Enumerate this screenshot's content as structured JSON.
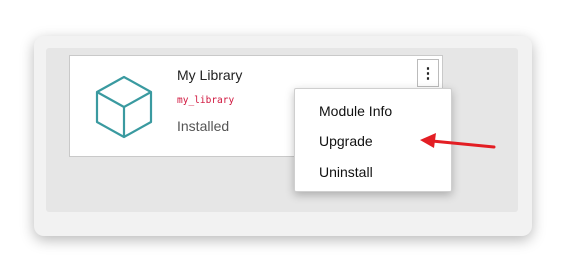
{
  "module": {
    "title": "My Library",
    "machine_name": "my_library",
    "status": "Installed",
    "icon": "cube-icon"
  },
  "actions_button": {
    "glyph": "⋮",
    "icon": "kebab-menu-icon"
  },
  "menu": {
    "items": [
      {
        "label": "Module Info"
      },
      {
        "label": "Upgrade"
      },
      {
        "label": "Uninstall"
      }
    ]
  },
  "annotation": {
    "icon": "red-arrow-icon",
    "color": "#e31e24"
  },
  "colors": {
    "machine_name": "#d0143c",
    "cube_stroke": "#3a9aa0"
  }
}
